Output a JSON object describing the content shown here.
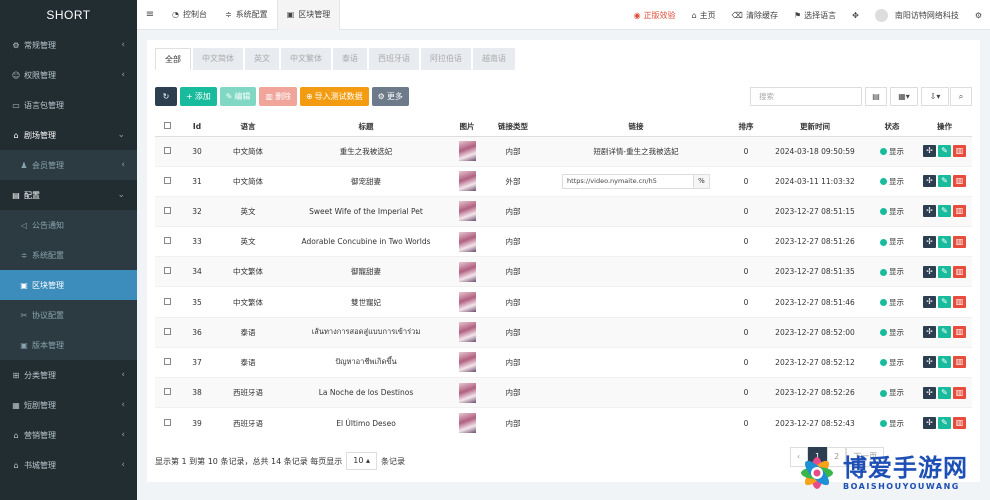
{
  "brand": "SHORT",
  "sidebar": {
    "items": [
      {
        "label": "常规管理",
        "icon": "gears-icon",
        "chevron": "‹"
      },
      {
        "label": "权限管理",
        "icon": "users-icon",
        "chevron": "‹"
      },
      {
        "label": "语言包管理",
        "icon": "document-icon",
        "chevron": ""
      },
      {
        "label": "剧场管理",
        "icon": "home-icon",
        "chevron": "⌄"
      },
      {
        "label": "会员管理",
        "icon": "user-icon",
        "chevron": "‹"
      },
      {
        "label": "配置",
        "icon": "file-icon",
        "chevron": "⌄"
      },
      {
        "label": "公告通知",
        "icon": "bullhorn-icon",
        "chevron": ""
      },
      {
        "label": "系统配置",
        "icon": "sliders-icon",
        "chevron": ""
      },
      {
        "label": "区块管理",
        "icon": "image-icon",
        "chevron": ""
      },
      {
        "label": "协议配置",
        "icon": "wrench-icon",
        "chevron": ""
      },
      {
        "label": "版本管理",
        "icon": "image-icon",
        "chevron": ""
      },
      {
        "label": "分类管理",
        "icon": "sitemap-icon",
        "chevron": "‹"
      },
      {
        "label": "短剧管理",
        "icon": "film-icon",
        "chevron": "‹"
      },
      {
        "label": "营销管理",
        "icon": "home-icon",
        "chevron": "‹"
      },
      {
        "label": "书城管理",
        "icon": "home-icon",
        "chevron": "‹"
      }
    ]
  },
  "topbar": {
    "toggle_icon": "≡",
    "tabs": [
      {
        "label": "控制台",
        "icon": "dashboard-icon"
      },
      {
        "label": "系统配置",
        "icon": "sliders-icon"
      },
      {
        "label": "区块管理",
        "icon": "image-icon"
      }
    ],
    "links": [
      {
        "label": "正版效验",
        "icon": "rss-icon"
      },
      {
        "label": "主页",
        "icon": "home-icon"
      },
      {
        "label": "清除缓存",
        "icon": "trash-icon"
      },
      {
        "label": "选择语言",
        "icon": "language-icon"
      }
    ],
    "user": "南阳访特网络科技"
  },
  "lang_tabs": [
    "全部",
    "中文简体",
    "英文",
    "中文繁体",
    "泰语",
    "西班牙语",
    "阿拉伯语",
    "越南语"
  ],
  "toolbar": {
    "refresh": "↻",
    "add": "添加",
    "edit": "编辑",
    "delete": "删除",
    "import": "导入测试数据",
    "more": "更多"
  },
  "search": {
    "placeholder": "搜索"
  },
  "table": {
    "headers": {
      "id": "Id",
      "lang": "语言",
      "title": "标题",
      "image": "图片",
      "link_type": "链接类型",
      "link": "链接",
      "sort": "排序",
      "updated": "更新时间",
      "status": "状态",
      "ops": "操作"
    },
    "rows": [
      {
        "id": "30",
        "lang": "中文简体",
        "title": "重生之我被选妃",
        "link_type": "内部",
        "link": "短剧详情-重生之我被选妃",
        "link_input": "",
        "sort": "0",
        "updated": "2024-03-18 09:50:59",
        "status": "显示"
      },
      {
        "id": "31",
        "lang": "中文简体",
        "title": "御宠甜妻",
        "link_type": "外部",
        "link": "",
        "link_input": "https://video.nymaite.cn/h5",
        "sort": "0",
        "updated": "2024-03-11 11:03:32",
        "status": "显示"
      },
      {
        "id": "32",
        "lang": "英文",
        "title": "Sweet Wife of the Imperial Pet",
        "link_type": "内部",
        "link": "",
        "link_input": "",
        "sort": "0",
        "updated": "2023-12-27 08:51:15",
        "status": "显示"
      },
      {
        "id": "33",
        "lang": "英文",
        "title": "Adorable Concubine in Two Worlds",
        "link_type": "内部",
        "link": "",
        "link_input": "",
        "sort": "0",
        "updated": "2023-12-27 08:51:26",
        "status": "显示"
      },
      {
        "id": "34",
        "lang": "中文繁体",
        "title": "御寵甜妻",
        "link_type": "内部",
        "link": "",
        "link_input": "",
        "sort": "0",
        "updated": "2023-12-27 08:51:35",
        "status": "显示"
      },
      {
        "id": "35",
        "lang": "中文繁体",
        "title": "雙世寵妃",
        "link_type": "内部",
        "link": "",
        "link_input": "",
        "sort": "0",
        "updated": "2023-12-27 08:51:46",
        "status": "显示"
      },
      {
        "id": "36",
        "lang": "泰语",
        "title": "เส้นทางการสอดสู่แบบการเข้าร่วม",
        "link_type": "内部",
        "link": "",
        "link_input": "",
        "sort": "0",
        "updated": "2023-12-27 08:52:00",
        "status": "显示"
      },
      {
        "id": "37",
        "lang": "泰语",
        "title": "ปัญหาอาชีพเกิดขึ้น",
        "link_type": "内部",
        "link": "",
        "link_input": "",
        "sort": "0",
        "updated": "2023-12-27 08:52:12",
        "status": "显示"
      },
      {
        "id": "38",
        "lang": "西班牙语",
        "title": "La Noche de los Destinos",
        "link_type": "内部",
        "link": "",
        "link_input": "",
        "sort": "0",
        "updated": "2023-12-27 08:52:26",
        "status": "显示"
      },
      {
        "id": "39",
        "lang": "西班牙语",
        "title": "El Último Deseo",
        "link_type": "内部",
        "link": "",
        "link_input": "",
        "sort": "0",
        "updated": "2023-12-27 08:52:43",
        "status": "显示"
      }
    ]
  },
  "footer": {
    "info": "显示第 1 到第 10 条记录，总共 14 条记录 每页显示",
    "page_size": "10",
    "suffix": "条记录",
    "pages": [
      "1",
      "2"
    ],
    "next": "下一页"
  },
  "watermark": {
    "cn": "博爱手游网",
    "en": "BOAISHOUYOUWANG"
  },
  "colors": {
    "sidebar": "#222d32",
    "active": "#3c8dbc",
    "green": "#18bc9c",
    "red": "#e74c3c",
    "orange": "#f39c12",
    "dark": "#2c3e50"
  }
}
